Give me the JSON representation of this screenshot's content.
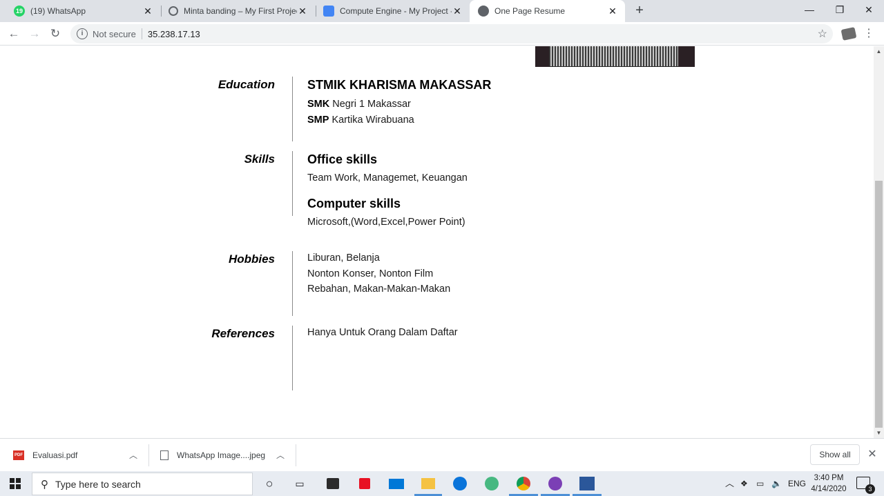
{
  "browser": {
    "tabs": [
      {
        "title": "(19) WhatsApp",
        "favicon": "whatsapp-icon",
        "badge": "19",
        "active": false
      },
      {
        "title": "Minta banding – My First Project",
        "favicon": "gear-icon",
        "active": false
      },
      {
        "title": "Compute Engine - My Project - G",
        "favicon": "compute-engine-icon",
        "active": false
      },
      {
        "title": "One Page Resume",
        "favicon": "globe-icon",
        "active": true
      }
    ],
    "new_tab_label": "+",
    "address": {
      "security_label": "Not secure",
      "url": "35.238.17.13"
    }
  },
  "resume": {
    "sections": [
      {
        "label": "Education",
        "heading": "STMIK KHARISMA MAKASSAR",
        "lines": [
          {
            "bold": "SMK",
            "text": " Negri 1 Makassar"
          },
          {
            "bold": "SMP",
            "text": " Kartika Wirabuana"
          }
        ]
      },
      {
        "label": "Skills",
        "groups": [
          {
            "heading": "Office skills",
            "text": "Team Work, Managemet, Keuangan"
          },
          {
            "heading": "Computer skills",
            "text": "Microsoft,(Word,Excel,Power Point)"
          }
        ]
      },
      {
        "label": "Hobbies",
        "lines": [
          "Liburan, Belanja",
          "Nonton Konser, Nonton Film",
          "Rebahan, Makan-Makan-Makan"
        ]
      },
      {
        "label": "References",
        "lines": [
          "Hanya Untuk Orang Dalam Daftar"
        ]
      }
    ]
  },
  "downloads": {
    "items": [
      {
        "name": "Evaluasi.pdf",
        "icon": "pdf-icon",
        "icon_text": "PDF"
      },
      {
        "name": "WhatsApp Image....jpeg",
        "icon": "image-file-icon"
      }
    ],
    "show_all_label": "Show all"
  },
  "taskbar": {
    "search_placeholder": "Type here to search",
    "language": "ENG",
    "time": "3:40 PM",
    "date": "4/14/2020",
    "notification_count": "3"
  }
}
